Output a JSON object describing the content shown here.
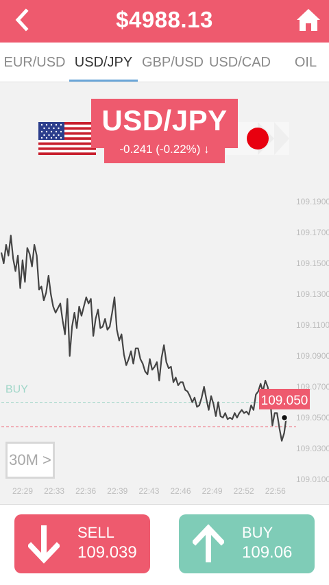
{
  "header": {
    "balance": "$4988.13",
    "back_icon": "chevron-left-icon",
    "home_icon": "home-icon"
  },
  "tabs": [
    {
      "label": "EUR/USD",
      "active": false
    },
    {
      "label": "USD/JPY",
      "active": true
    },
    {
      "label": "GBP/USD",
      "active": false
    },
    {
      "label": "USD/CAD",
      "active": false
    },
    {
      "label": "OIL",
      "active": false
    }
  ],
  "pair": {
    "name": "USD/JPY",
    "change": "-0.241 (-0.22%) ↓",
    "base_flag": "us-flag-icon",
    "quote_flag": "japan-flag-icon"
  },
  "colors": {
    "accent": "#ee5a6e",
    "buy": "#7fccb7",
    "line": "#444444",
    "buy_level": "#9fd6c8",
    "current_level": "#ee5a6e"
  },
  "chart_data": {
    "type": "line",
    "ylim": [
      109.01,
      109.19
    ],
    "y_ticks": [
      "109.1900",
      "109.1700",
      "109.1500",
      "109.1300",
      "109.1100",
      "109.0900",
      "109.0700",
      "109.0500",
      "109.0300",
      "109.0100"
    ],
    "x_ticks": [
      "22:29",
      "22:33",
      "22:36",
      "22:39",
      "22:43",
      "22:46",
      "22:49",
      "22:52",
      "22:56"
    ],
    "series": [
      {
        "values": [
          109.157,
          109.15,
          109.162,
          109.155,
          109.168,
          109.153,
          109.145,
          109.155,
          109.134,
          109.152,
          109.138,
          109.16,
          109.156,
          109.148,
          109.162,
          109.155,
          109.133,
          109.135,
          109.126,
          109.131,
          109.142,
          109.13,
          109.122,
          109.118,
          109.121,
          109.124,
          109.113,
          109.104,
          109.127,
          109.09,
          109.109,
          109.118,
          109.108,
          109.122,
          109.116,
          109.122,
          109.128,
          109.124,
          109.127,
          109.103,
          109.114,
          109.12,
          109.108,
          109.109,
          109.114,
          109.107,
          109.109,
          109.118,
          109.128,
          109.107,
          109.1,
          109.104,
          109.091,
          109.084,
          109.088,
          109.093,
          109.085,
          109.095,
          109.095,
          109.088,
          109.085,
          109.08,
          109.078,
          109.088,
          109.081,
          109.083,
          109.086,
          109.074,
          109.089,
          109.097,
          109.086,
          109.082,
          109.083,
          109.073,
          109.076,
          109.071,
          109.073,
          109.073,
          109.068,
          109.067,
          109.064,
          109.06,
          109.063,
          109.057,
          109.058,
          109.063,
          109.07,
          109.062,
          109.055,
          109.064,
          109.059,
          109.051,
          109.06,
          109.051,
          109.05,
          109.053,
          109.049,
          109.05,
          109.049,
          109.053,
          109.05,
          109.053,
          109.055,
          109.053,
          109.054,
          109.052,
          109.058,
          109.055,
          109.065,
          109.067,
          109.072,
          109.067,
          109.074,
          109.07,
          109.063,
          109.045,
          109.053,
          109.053,
          109.043,
          109.035,
          109.04,
          109.051
        ]
      }
    ],
    "buy_level": 109.06,
    "current_level": 109.0441,
    "buy_label": "BUY",
    "current_label": "109.050",
    "current_value": 109.05
  },
  "interval": "30M >",
  "sell": {
    "label": "SELL",
    "price": "109.039",
    "icon": "arrow-down-icon"
  },
  "buy": {
    "label": "BUY",
    "price": "109.06",
    "icon": "arrow-up-icon"
  }
}
